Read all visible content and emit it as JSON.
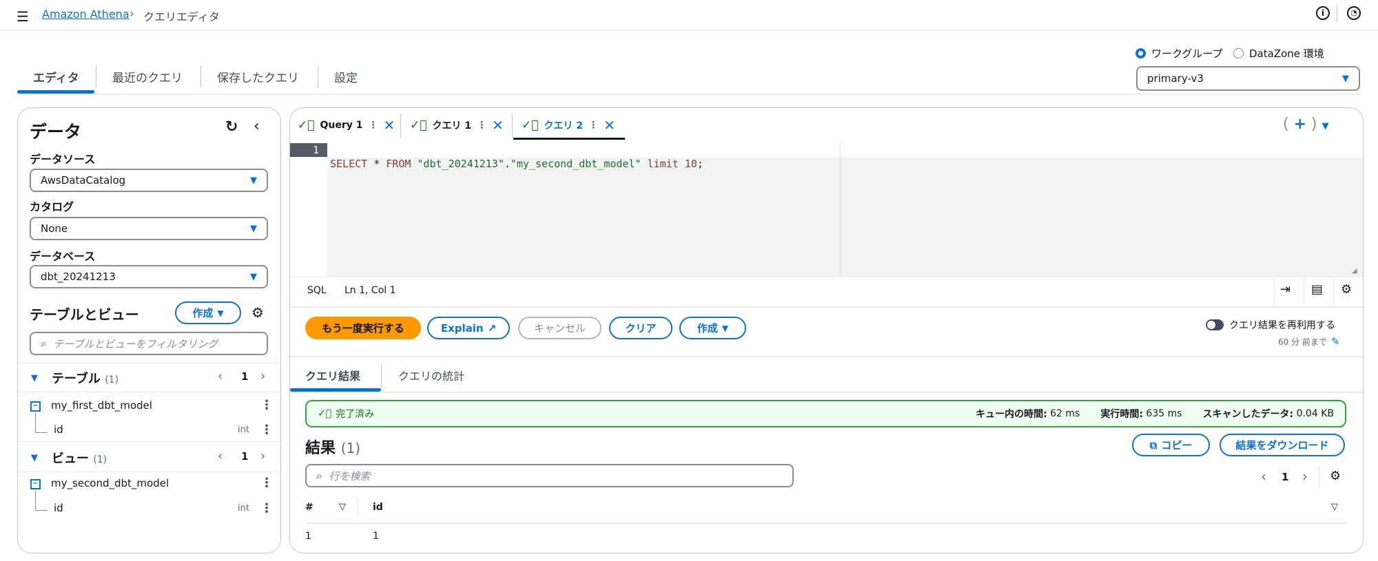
{
  "topbar": {
    "breadcrumb_root": "Amazon Athena",
    "breadcrumb_current": "クエリエディタ",
    "menu_icon": "hamburger-icon",
    "info_icon": "info-icon",
    "settings_icon": "gear-icon"
  },
  "tabs": [
    {
      "label": "エディタ",
      "active": true
    },
    {
      "label": "最近のクエリ"
    },
    {
      "label": "保存したクエリ"
    },
    {
      "label": "設定"
    }
  ],
  "workgroup": {
    "radio_workgroup": "ワークグループ",
    "radio_datazone": "DataZone 環境",
    "selected": "ワークグループ",
    "select_value": "primary-v3"
  },
  "data_panel": {
    "title": "データ",
    "datasource_label": "データソース",
    "datasource_value": "AwsDataCatalog",
    "catalog_label": "カタログ",
    "catalog_value": "None",
    "database_label": "データベース",
    "database_value": "dbt_20241213",
    "tables_views_title": "テーブルとビュー",
    "create_label": "作成",
    "filter_placeholder": "テーブルとビューをフィルタリング",
    "tables": {
      "label": "テーブル",
      "count": "(1)",
      "page": "1",
      "items": [
        {
          "name": "my_first_dbt_model",
          "column": "id",
          "type": "int"
        }
      ]
    },
    "views": {
      "label": "ビュー",
      "count": "(1)",
      "page": "1",
      "items": [
        {
          "name": "my_second_dbt_model",
          "column": "id",
          "type": "int"
        }
      ]
    }
  },
  "editor": {
    "query_tabs": [
      {
        "label": "Query 1"
      },
      {
        "label": "クエリ 1"
      },
      {
        "label": "クエリ 2",
        "active": true
      }
    ],
    "line_number": "1",
    "code": {
      "kw1": "SELECT",
      "star": " * ",
      "kw2": "FROM",
      "s1": " \"dbt_20241213\"",
      "dot": ".",
      "s2": "\"my_second_dbt_model\"",
      "kw3": " limit ",
      "num": "10",
      "end": ";"
    },
    "status_lang": "SQL",
    "status_pos": "Ln 1, Col 1"
  },
  "actions": {
    "run": "もう一度実行する",
    "explain": "Explain",
    "cancel": "キャンセル",
    "clear": "クリア",
    "create": "作成",
    "reuse_label": "クエリ結果を再利用する",
    "reuse_sub": "60 分 前まで",
    "reuse_enabled": false
  },
  "results_tabs": [
    {
      "label": "クエリ結果",
      "active": true
    },
    {
      "label": "クエリの統計"
    }
  ],
  "status": {
    "label": "完了済み",
    "queue_label": "キュー内の時間:",
    "queue_value": "62 ms",
    "exec_label": "実行時間:",
    "exec_value": "635 ms",
    "scan_label": "スキャンしたデータ:",
    "scan_value": "0.04 KB"
  },
  "results": {
    "title": "結果",
    "count": "(1)",
    "copy": "コピー",
    "download": "結果をダウンロード",
    "search_placeholder": "行を検索",
    "page": "1",
    "columns": [
      "#",
      "id"
    ],
    "rows": [
      [
        "1",
        "1"
      ]
    ]
  },
  "colors": {
    "accent": "#0972d3",
    "run_button": "#ff9900",
    "success": "#037f0c"
  }
}
